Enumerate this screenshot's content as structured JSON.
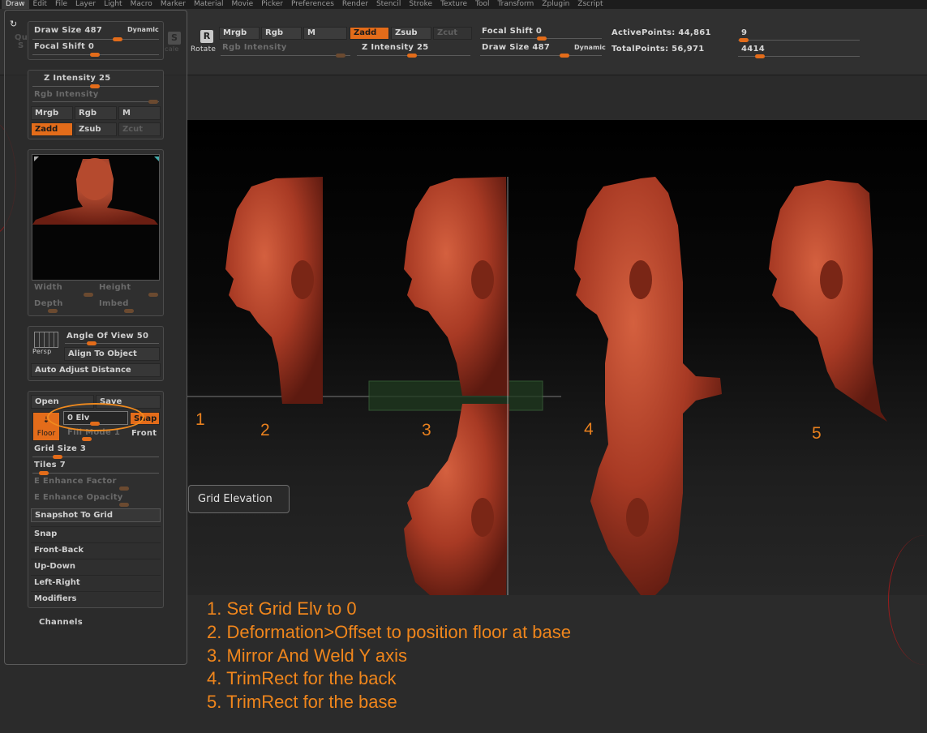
{
  "menubar": [
    "Draw",
    "Edit",
    "File",
    "Layer",
    "Light",
    "Macro",
    "Marker",
    "Material",
    "Movie",
    "Picker",
    "Preferences",
    "Render",
    "Stencil",
    "Stroke",
    "Texture",
    "Tool",
    "Transform",
    "Zplugin",
    "Zscript"
  ],
  "toolbar": {
    "rotate_label": "Rotate",
    "r_icon": "R",
    "s_icon": "S",
    "scale_label": "cale",
    "qu_label": "Qu",
    "s_label": "S",
    "mrgb": "Mrgb",
    "rgb": "Rgb",
    "m": "M",
    "zadd": "Zadd",
    "zsub": "Zsub",
    "zcut": "Zcut",
    "rgb_intensity": "Rgb Intensity",
    "z_intensity": "Z Intensity 25",
    "focal_shift": "Focal Shift 0",
    "draw_size": "Draw Size 487",
    "dynamic": "Dynamic",
    "active_points": "ActivePoints: 44,861",
    "total_points": "TotalPoints: 56,971",
    "value_a": "9",
    "value_b": "4414"
  },
  "panel": {
    "draw_size": "Draw Size 487",
    "dynamic": "Dynamic",
    "focal_shift": "Focal Shift 0",
    "z_intensity": "Z Intensity 25",
    "rgb_intensity": "Rgb Intensity",
    "mrgb": "Mrgb",
    "rgb": "Rgb",
    "m": "M",
    "zadd": "Zadd",
    "zsub": "Zsub",
    "zcut": "Zcut",
    "width": "Width",
    "height": "Height",
    "depth": "Depth",
    "imbed": "Imbed",
    "angle_of_view": "Angle Of View 50",
    "persp": "Persp",
    "align_to_object": "Align To Object",
    "auto_adjust_distance": "Auto Adjust Distance",
    "open": "Open",
    "save": "Save",
    "elv": "0 Elv",
    "snap_btn": "Snap",
    "floor": "Floor",
    "fill_mode": "Fill Mode 1",
    "front": "Front",
    "grid_size": "Grid Size 3",
    "tiles": "Tiles 7",
    "e_enhance_factor": "E Enhance Factor",
    "e_enhance_opacity": "E Enhance Opacity",
    "snapshot_to_grid": "Snapshot To Grid",
    "list": [
      "Snap",
      "Front-Back",
      "Up-Down",
      "Left-Right",
      "Modifiers"
    ],
    "channels": "Channels"
  },
  "tooltip": "Grid Elevation",
  "step_numbers": [
    "1",
    "2",
    "3",
    "4",
    "5"
  ],
  "instructions": [
    "1. Set Grid Elv to 0",
    "2. Deformation>Offset to position floor at base",
    "3. Mirror And Weld Y axis",
    "4. TrimRect for the back",
    "5. TrimRect for the base"
  ],
  "colors": {
    "accent": "#e36c1a",
    "annotation": "#f0861c",
    "model": "#b5422b"
  }
}
